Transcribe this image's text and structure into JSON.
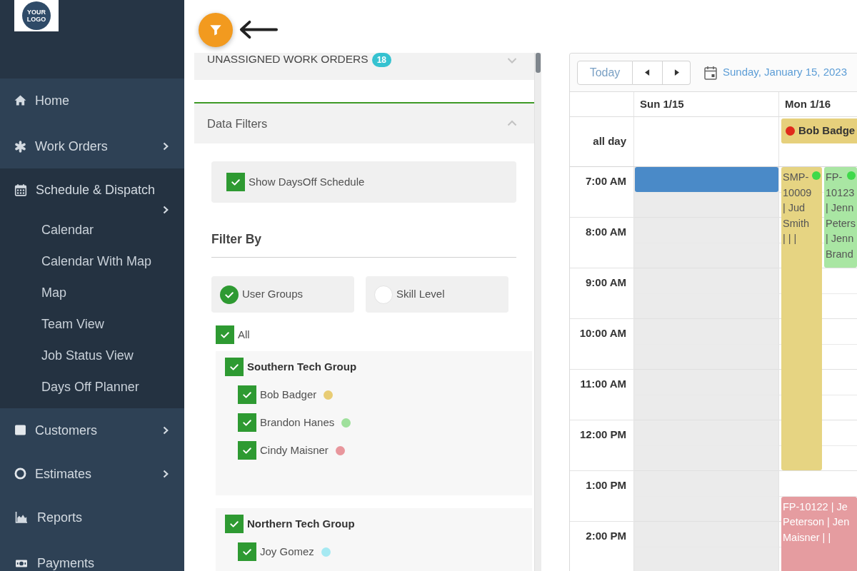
{
  "sidebar": {
    "logo": {
      "lines": [
        "YOUR",
        "LOGO"
      ]
    },
    "items": [
      {
        "label": "Home",
        "kind": "link"
      },
      {
        "label": "Work Orders",
        "kind": "submenu",
        "expanded": false
      },
      {
        "label": "Schedule & Dispatch",
        "kind": "submenu",
        "expanded": true,
        "children": [
          {
            "label": "Calendar"
          },
          {
            "label": "Calendar With Map"
          },
          {
            "label": "Map"
          },
          {
            "label": "Team View"
          },
          {
            "label": "Job Status View"
          },
          {
            "label": "Days Off Planner"
          }
        ]
      },
      {
        "label": "Customers",
        "kind": "submenu",
        "expanded": false
      },
      {
        "label": "Estimates",
        "kind": "submenu",
        "expanded": false
      },
      {
        "label": "Reports",
        "kind": "link"
      },
      {
        "label": "Payments",
        "kind": "link"
      }
    ]
  },
  "panel": {
    "unassigned": {
      "title": "UNASSIGNED WORK ORDERS",
      "badge": "18",
      "expanded": false
    },
    "data_filters": {
      "title": "Data Filters",
      "expanded": true,
      "days_off": {
        "label": "Show DaysOff Schedule",
        "checked": true
      },
      "filter_by": {
        "title": "Filter By",
        "options": [
          {
            "label": "User Groups",
            "selected": true
          },
          {
            "label": "Skill Level",
            "selected": false
          }
        ]
      },
      "tree": {
        "label": "All",
        "checked": true,
        "children": [
          {
            "label": "Southern Tech Group",
            "checked": true,
            "children": [
              {
                "label": "Bob Badger",
                "checked": true,
                "color": "#e8cc74"
              },
              {
                "label": "Brandon Hanes",
                "checked": true,
                "color": "#9fe09c"
              },
              {
                "label": "Cindy Maisner",
                "checked": true,
                "color": "#e8969c"
              }
            ]
          },
          {
            "label": "Northern Tech Group",
            "checked": true,
            "children": [
              {
                "label": "Joy Gomez",
                "checked": true,
                "color": "#a6e9f2"
              }
            ]
          }
        ]
      }
    }
  },
  "calendar": {
    "toolbar": {
      "today": "Today",
      "date": "Sunday, January 15, 2023"
    },
    "all_day_label": "all day",
    "time_slots": [
      "7:00 AM",
      "8:00 AM",
      "9:00 AM",
      "10:00 AM",
      "11:00 AM",
      "12:00 PM",
      "1:00 PM",
      "2:00 PM"
    ],
    "days": [
      {
        "label": "Sun 1/15",
        "day_off": true,
        "events": [
          {
            "color": "#4a8ac8"
          }
        ]
      },
      {
        "label": "Mon 1/16",
        "day_off": false,
        "all_day": [
          {
            "text": "Bob Badge",
            "color": "#e6d07c",
            "status_dot": {
              "color": "#e02a1c"
            }
          }
        ],
        "events": [
          {
            "lines": [
              "SMP-",
              "10009",
              "| Jud",
              "Smith",
              "| | |"
            ],
            "color": "#e6d482",
            "status_dot": {
              "color": "#3fd94a"
            }
          },
          {
            "lines": [
              "FP-",
              "10123",
              "| Jenn",
              "Peters",
              "| Jenn",
              "Brand"
            ],
            "color": "#a9e6a3",
            "status_dot": {
              "color": "#3fd94a"
            }
          },
          {
            "lines": [
              "FP-10122 | Je",
              "Peterson | Jen",
              "Maisner | |"
            ],
            "color": "#e59ca0"
          }
        ]
      }
    ]
  }
}
